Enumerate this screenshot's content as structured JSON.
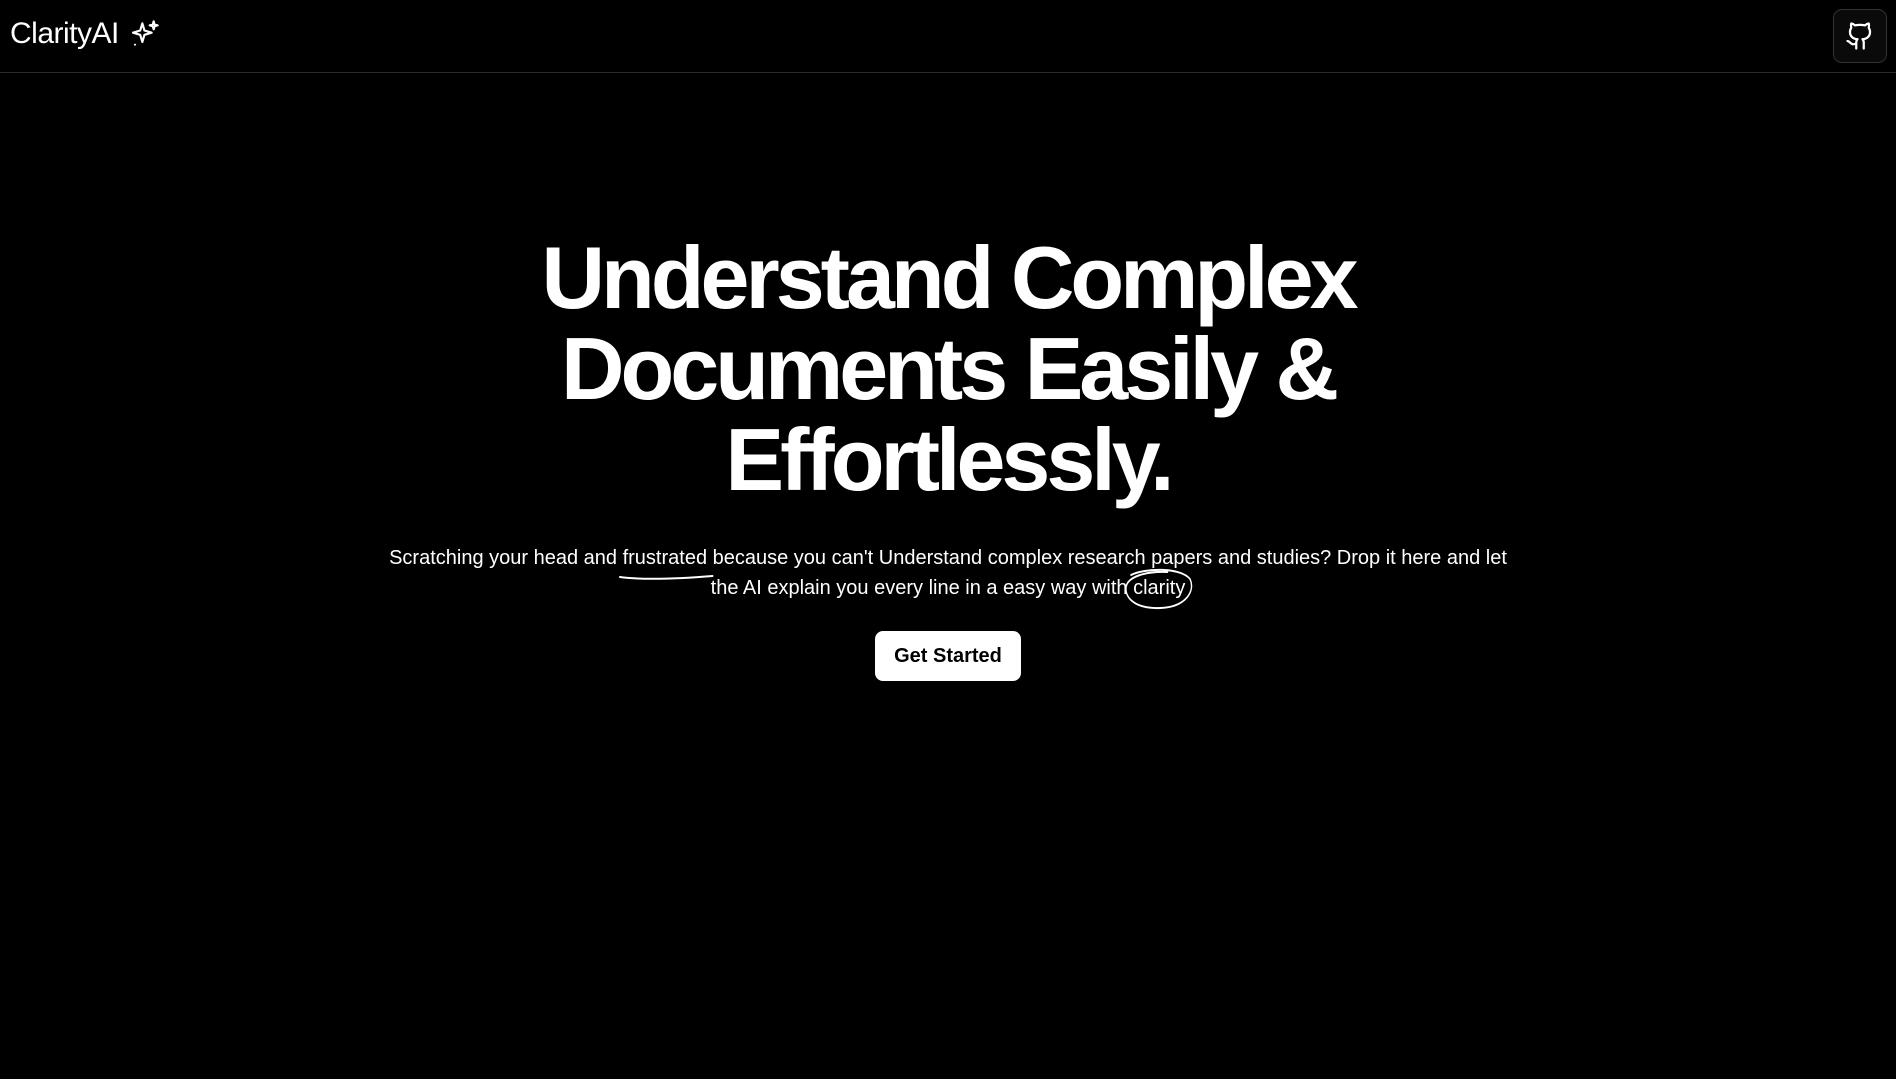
{
  "colors": {
    "background": "#000000",
    "text": "#ffffff",
    "button_bg": "#ffffff",
    "button_text": "#000000",
    "border": "#2a2a2a"
  },
  "navbar": {
    "brand": "ClarityAI",
    "brand_icon": "sparkles-icon",
    "github_icon": "github-icon"
  },
  "hero": {
    "headline_line1": "Understand Complex",
    "headline_line2": "Documents Easily &",
    "headline_line3": "Effortlessly.",
    "subtitle_part1": "Scratching your head and ",
    "subtitle_emphasis1": "frustrated",
    "subtitle_part2": " because you can't Understand complex research papers and studies? Drop it here and let the AI explain you every line in a easy way with ",
    "subtitle_emphasis2": "clarity",
    "cta_label": "Get Started"
  }
}
